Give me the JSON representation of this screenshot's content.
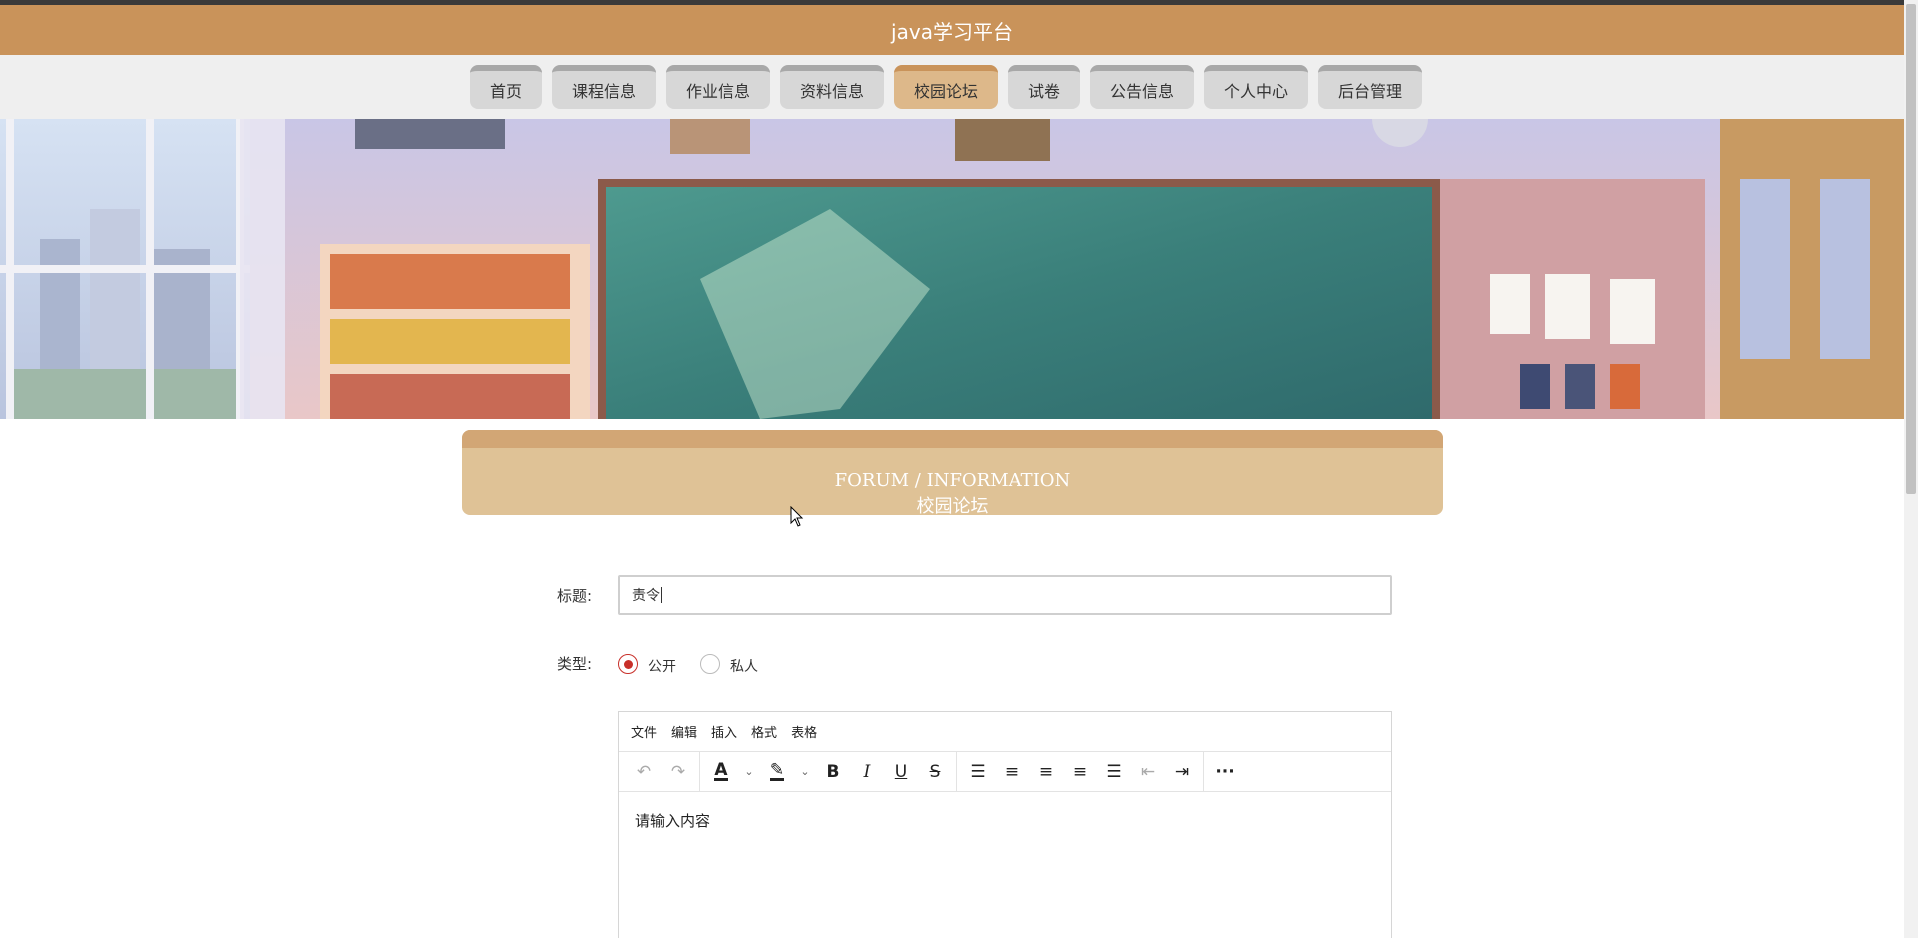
{
  "app": {
    "title": "java学习平台"
  },
  "nav": {
    "items": [
      {
        "label": "首页",
        "active": false
      },
      {
        "label": "课程信息",
        "active": false
      },
      {
        "label": "作业信息",
        "active": false
      },
      {
        "label": "资料信息",
        "active": false
      },
      {
        "label": "校园论坛",
        "active": true
      },
      {
        "label": "试卷",
        "active": false
      },
      {
        "label": "公告信息",
        "active": false
      },
      {
        "label": "个人中心",
        "active": false
      },
      {
        "label": "后台管理",
        "active": false
      }
    ]
  },
  "section": {
    "title_en": "FORUM / INFORMATION",
    "title_cn": "校园论坛"
  },
  "form": {
    "title_label": "标题:",
    "title_value": "责令",
    "type_label": "类型:",
    "type_options": [
      {
        "label": "公开",
        "checked": true
      },
      {
        "label": "私人",
        "checked": false
      }
    ]
  },
  "editor": {
    "menus": [
      "文件",
      "编辑",
      "插入",
      "格式",
      "表格"
    ],
    "toolbar_icons": [
      "undo-icon",
      "redo-icon",
      "text-color-icon",
      "highlight-color-icon",
      "bold-icon",
      "italic-icon",
      "underline-icon",
      "strikethrough-icon",
      "line-height-icon",
      "align-left-icon",
      "align-center-icon",
      "align-right-icon",
      "align-justify-icon",
      "outdent-icon",
      "indent-icon",
      "more-icon"
    ],
    "placeholder": "请输入内容"
  },
  "colors": {
    "header": "#c9935a",
    "accent_active": "#ddb88a",
    "section_band": "#dfc296",
    "radio_checked": "#c8302a"
  }
}
